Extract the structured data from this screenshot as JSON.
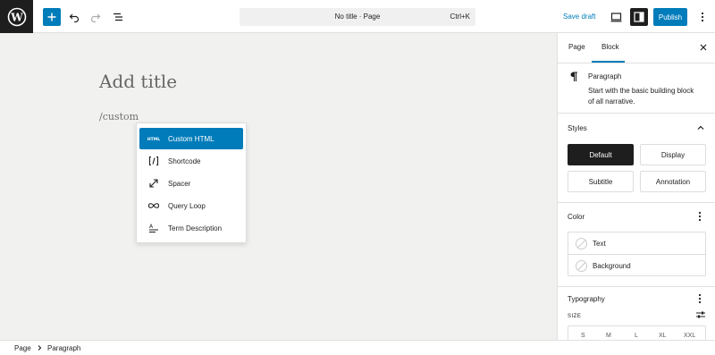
{
  "topbar": {
    "wp_logo_icon": "wordpress-logo-icon",
    "document_title": "No title · Page",
    "shortcut": "Ctrl+K",
    "save_draft": "Save draft",
    "publish": "Publish"
  },
  "canvas": {
    "title_placeholder": "Add title",
    "slash_text": "/custom",
    "autocomplete": [
      {
        "label": "Custom HTML",
        "icon": "html-icon",
        "selected": true
      },
      {
        "label": "Shortcode",
        "icon": "shortcode-icon",
        "selected": false
      },
      {
        "label": "Spacer",
        "icon": "spacer-icon",
        "selected": false
      },
      {
        "label": "Query Loop",
        "icon": "loop-icon",
        "selected": false
      },
      {
        "label": "Term Description",
        "icon": "term-description-icon",
        "selected": false
      }
    ]
  },
  "sidebar": {
    "tabs": [
      "Page",
      "Block"
    ],
    "active_tab": "Block",
    "block": {
      "name": "Paragraph",
      "description": "Start with the basic building block of all narrative."
    },
    "styles": {
      "title": "Styles",
      "options": [
        "Default",
        "Display",
        "Subtitle",
        "Annotation"
      ],
      "active": "Default"
    },
    "color": {
      "title": "Color",
      "items": [
        "Text",
        "Background"
      ]
    },
    "typography": {
      "title": "Typography",
      "size_label": "SIZE",
      "sizes": [
        "S",
        "M",
        "L",
        "XL",
        "XXL"
      ]
    }
  },
  "footer": {
    "breadcrumb": [
      "Page",
      "Paragraph"
    ]
  },
  "colors": {
    "accent": "#007cba",
    "dark": "#1e1e1e",
    "canvas_bg": "#f1f1f0"
  }
}
